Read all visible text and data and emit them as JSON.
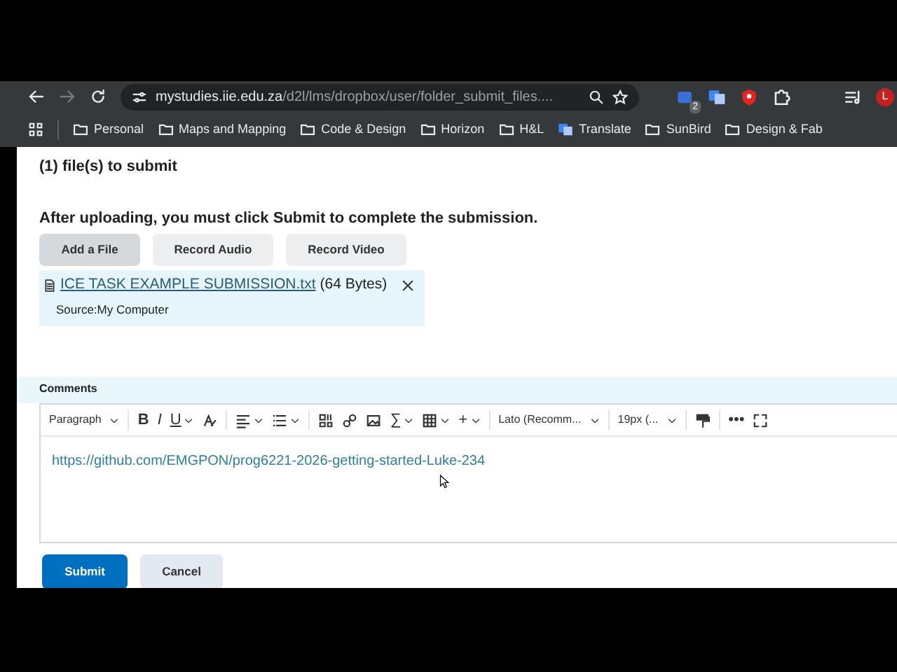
{
  "browser": {
    "back": {
      "disabled": false
    },
    "forward": {
      "disabled": true
    },
    "address_host": "mystudies.iie.edu.za",
    "address_path": "/d2l/lms/dropbox/user/folder_submit_files....",
    "extension_badge": "2",
    "profile_initial": "L"
  },
  "bookmarks": [
    {
      "kind": "folder",
      "label": "Personal"
    },
    {
      "kind": "folder",
      "label": "Maps and Mapping"
    },
    {
      "kind": "folder",
      "label": "Code & Design"
    },
    {
      "kind": "folder",
      "label": "Horizon"
    },
    {
      "kind": "folder",
      "label": "H&L"
    },
    {
      "kind": "translate",
      "label": "Translate"
    },
    {
      "kind": "folder",
      "label": "SunBird"
    },
    {
      "kind": "folder",
      "label": "Design & Fab"
    }
  ],
  "page": {
    "files_heading": "(1) file(s) to submit",
    "instruction": "After uploading, you must click Submit to complete the submission.",
    "upload_buttons": [
      {
        "label": "Add a File",
        "selected": true
      },
      {
        "label": "Record Audio",
        "selected": false
      },
      {
        "label": "Record Video",
        "selected": false
      }
    ],
    "file": {
      "name": "ICE TASK EXAMPLE SUBMISSION.txt",
      "size": "(64 Bytes)",
      "source": "Source:My Computer"
    },
    "comments": {
      "label": "Comments",
      "toolbar": [
        {
          "kind": "dropdown",
          "label": "Paragraph"
        },
        {
          "kind": "sep"
        },
        {
          "kind": "bold",
          "label": "B"
        },
        {
          "kind": "italic",
          "label": "I"
        },
        {
          "kind": "underline",
          "label": "U",
          "caret": true
        },
        {
          "kind": "format"
        },
        {
          "kind": "sep"
        },
        {
          "kind": "align",
          "caret": true
        },
        {
          "kind": "list",
          "caret": true
        },
        {
          "kind": "sep"
        },
        {
          "kind": "media"
        },
        {
          "kind": "link"
        },
        {
          "kind": "image"
        },
        {
          "kind": "text",
          "label": "∑",
          "caret": true
        },
        {
          "kind": "table",
          "caret": true
        },
        {
          "kind": "text",
          "label": "+",
          "caret": true
        },
        {
          "kind": "sep"
        },
        {
          "kind": "dropdown",
          "label": "Lato (Recomm..."
        },
        {
          "kind": "sep"
        },
        {
          "kind": "dropdown",
          "label": "19px (..."
        },
        {
          "kind": "sep"
        },
        {
          "kind": "paint"
        },
        {
          "kind": "sep"
        },
        {
          "kind": "text",
          "label": "•••"
        },
        {
          "kind": "fullscreen"
        }
      ],
      "body_link": "https://github.com/EMGPON/prog6221-2026-getting-started-Luke-234"
    },
    "form_buttons": [
      {
        "label": "Submit",
        "kind": "primary"
      },
      {
        "label": "Cancel",
        "kind": "secondary"
      }
    ]
  }
}
